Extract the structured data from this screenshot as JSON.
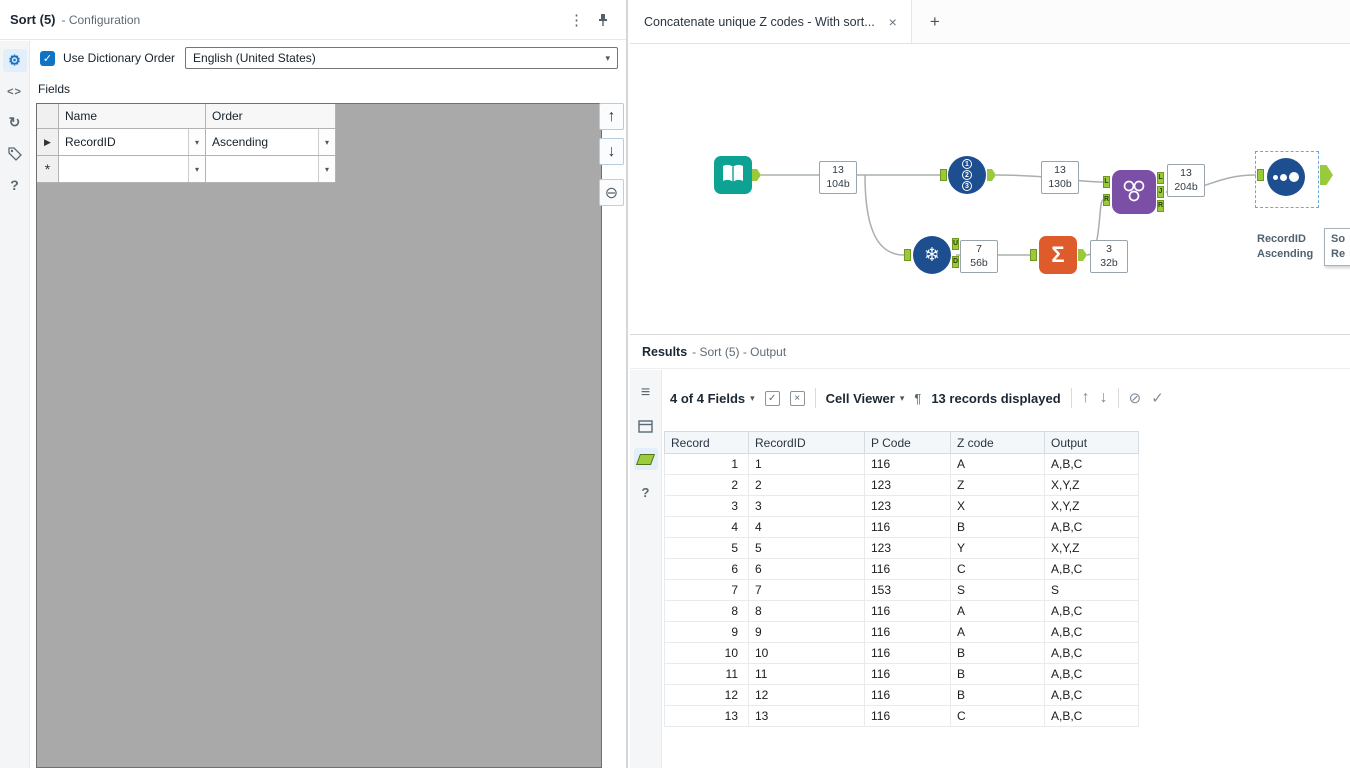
{
  "icons": {
    "kebab": "⋮",
    "gear": "⚙",
    "code": "<>",
    "refresh": "↻",
    "help": "?",
    "chevron_down": "▾",
    "row_marker": "▶",
    "new_row_marker": "*",
    "up_arrow": "↑",
    "down_arrow": "↓",
    "remove_row": "⊖",
    "close": "×",
    "new_tab": "+",
    "caret": "▾",
    "pilcrow": "¶",
    "select_all_check": "✓",
    "deselect_x": "×",
    "block": "⊘",
    "apply_check": "✓",
    "list": "≡",
    "snowflake": "❄",
    "sigma": "Σ"
  },
  "config": {
    "title": "Sort (5)",
    "subtitle": "- Configuration",
    "dictionary_label": "Use Dictionary Order",
    "language": "English (United States)",
    "fields_label": "Fields",
    "grid": {
      "name_header": "Name",
      "order_header": "Order",
      "row_name": "RecordID",
      "row_order": "Ascending"
    }
  },
  "tabs": {
    "active_label": "Concatenate unique Z codes - With sort..."
  },
  "canvas": {
    "recordid_numbers": [
      "1",
      "2",
      "3"
    ],
    "annotations": {
      "input": {
        "count": "13",
        "size": "104b"
      },
      "recordid": {
        "count": "13",
        "size": "130b"
      },
      "join": {
        "count": "13",
        "size": "204b"
      },
      "unique": {
        "count": "7",
        "size": "56b"
      },
      "summarize": {
        "count": "3",
        "size": "32b"
      }
    },
    "join_anchor_in": [
      "L",
      "R"
    ],
    "join_anchor_out": [
      "L",
      "J",
      "R"
    ],
    "unique_anchor_out": [
      "U",
      "D"
    ],
    "sort_annotation": {
      "line1": "RecordID",
      "line2": "Ascending"
    },
    "tooltip": {
      "line1": "So",
      "line2": "Re"
    }
  },
  "results": {
    "title": "Results",
    "subtitle": "- Sort (5) - Output",
    "toolbar": {
      "fields": "4 of 4 Fields",
      "cell_viewer": "Cell Viewer",
      "records": "13 records displayed"
    },
    "table": {
      "columns": [
        "Record",
        "RecordID",
        "P Code",
        "Z code",
        "Output"
      ],
      "rows": [
        [
          "1",
          "1",
          "116",
          "A",
          "A,B,C"
        ],
        [
          "2",
          "2",
          "123",
          "Z",
          "X,Y,Z"
        ],
        [
          "3",
          "3",
          "123",
          "X",
          "X,Y,Z"
        ],
        [
          "4",
          "4",
          "116",
          "B",
          "A,B,C"
        ],
        [
          "5",
          "5",
          "123",
          "Y",
          "X,Y,Z"
        ],
        [
          "6",
          "6",
          "116",
          "C",
          "A,B,C"
        ],
        [
          "7",
          "7",
          "153",
          "S",
          "S"
        ],
        [
          "8",
          "8",
          "116",
          "A",
          "A,B,C"
        ],
        [
          "9",
          "9",
          "116",
          "A",
          "A,B,C"
        ],
        [
          "10",
          "10",
          "116",
          "B",
          "A,B,C"
        ],
        [
          "11",
          "11",
          "116",
          "B",
          "A,B,C"
        ],
        [
          "12",
          "12",
          "116",
          "B",
          "A,B,C"
        ],
        [
          "13",
          "13",
          "116",
          "C",
          "A,B,C"
        ]
      ]
    }
  }
}
